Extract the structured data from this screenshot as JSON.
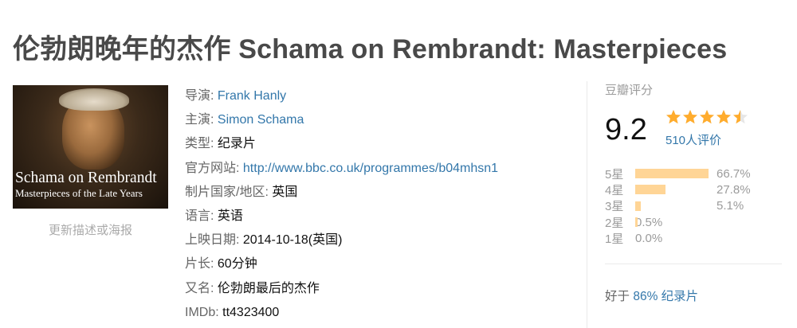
{
  "title": "伦勃朗晚年的杰作 Schama on Rembrandt: Masterpieces",
  "poster": {
    "title_line": "Schama on Rembrandt",
    "subtitle_line": "Masterpieces of the Late Years"
  },
  "update_link": "更新描述或海报",
  "info": {
    "director": {
      "label": "导演:",
      "value": "Frank Hanly"
    },
    "starring": {
      "label": "主演:",
      "value": "Simon Schama"
    },
    "genre": {
      "label": "类型:",
      "value": "纪录片"
    },
    "website": {
      "label": "官方网站:",
      "value": "http://www.bbc.co.uk/programmes/b04mhsn1"
    },
    "country": {
      "label": "制片国家/地区:",
      "value": "英国"
    },
    "language": {
      "label": "语言:",
      "value": "英语"
    },
    "release": {
      "label": "上映日期:",
      "value": "2014-10-18(英国)"
    },
    "runtime": {
      "label": "片长:",
      "value": "60分钟"
    },
    "aka": {
      "label": "又名:",
      "value": "伦勃朗最后的杰作"
    },
    "imdb": {
      "label": "IMDb:",
      "value": "tt4323400"
    }
  },
  "rating": {
    "label": "豆瓣评分",
    "score": "9.2",
    "stars": 4.5,
    "votes": "510人评价",
    "star_color": "#ffac2d",
    "bar_color": "#ffd596",
    "distribution": [
      {
        "label": "5星",
        "percent": 66.7,
        "text": "66.7%"
      },
      {
        "label": "4星",
        "percent": 27.8,
        "text": "27.8%"
      },
      {
        "label": "3星",
        "percent": 5.1,
        "text": "5.1%"
      },
      {
        "label": "2星",
        "percent": 0.5,
        "text": "0.5%"
      },
      {
        "label": "1星",
        "percent": 0.0,
        "text": "0.0%"
      }
    ],
    "better_than": {
      "prefix": "好于",
      "percent": "86%",
      "category": "纪录片"
    }
  }
}
